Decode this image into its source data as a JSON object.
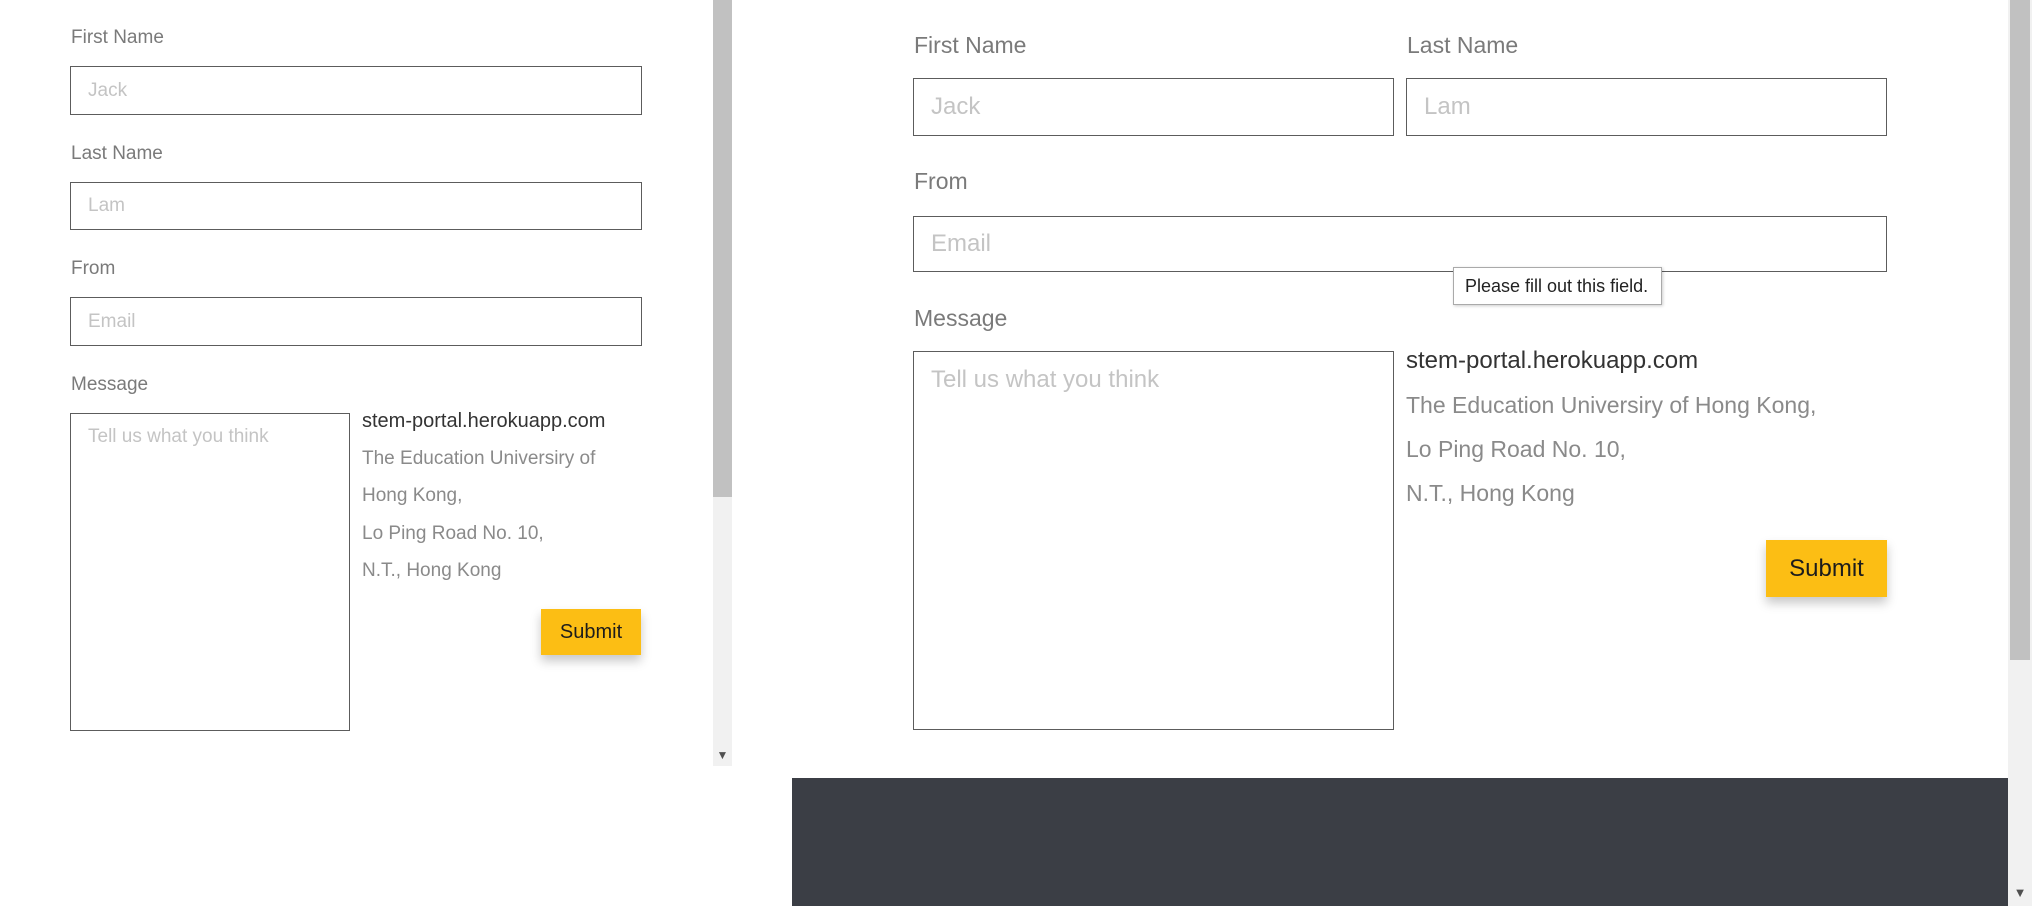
{
  "left_form": {
    "first_name_label": "First Name",
    "first_name_placeholder": "Jack",
    "last_name_label": "Last Name",
    "last_name_placeholder": "Lam",
    "from_label": "From",
    "email_placeholder": "Email",
    "message_label": "Message",
    "message_placeholder": "Tell us what you think",
    "site": "stem-portal.herokuapp.com",
    "address_line1": "The Education Universiry of",
    "address_line2": "Hong Kong,",
    "address_line3": "Lo Ping Road No. 10,",
    "address_line4": "N.T., Hong Kong",
    "submit_label": "Submit"
  },
  "right_form": {
    "first_name_label": "First Name",
    "first_name_placeholder": "Jack",
    "last_name_label": "Last Name",
    "last_name_placeholder": "Lam",
    "from_label": "From",
    "email_placeholder": "Email",
    "validation_tooltip": "Please fill out this field.",
    "message_label": "Message",
    "message_placeholder": "Tell us what you think",
    "site": "stem-portal.herokuapp.com",
    "address_line1": "The Education Universiry of Hong Kong,",
    "address_line2": "Lo Ping Road No. 10,",
    "address_line3": "N.T., Hong Kong",
    "submit_label": "Submit"
  },
  "scrollbar": {
    "down_arrow_glyph": "▼"
  },
  "colors": {
    "accent": "#fcbe14",
    "footer": "#3b3e45",
    "input_border": "#5c5c5c"
  }
}
